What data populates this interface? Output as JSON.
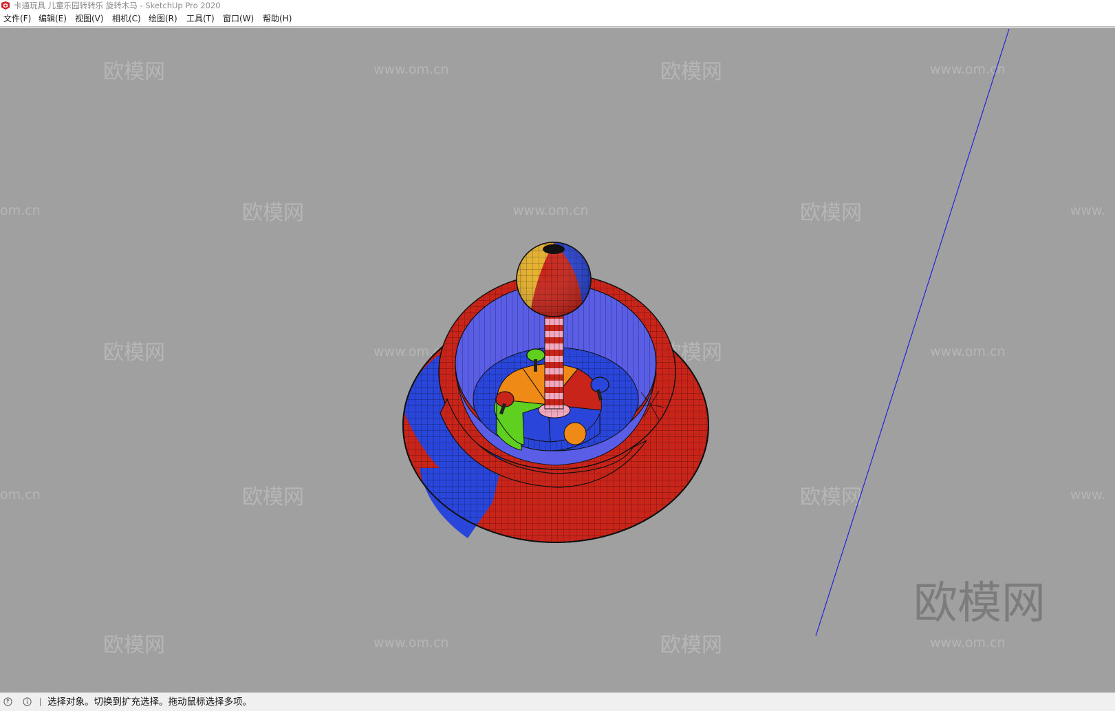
{
  "window": {
    "title": "卡通玩具 儿童乐园转转乐 旋转木马 - SketchUp Pro 2020",
    "app_icon": "sketchup-logo-icon"
  },
  "menu": {
    "items": [
      "文件(F)",
      "编辑(E)",
      "视图(V)",
      "相机(C)",
      "绘图(R)",
      "工具(T)",
      "窗口(W)",
      "帮助(H)"
    ]
  },
  "viewport": {
    "background": "#a0a0a0",
    "watermark_logo": "欧模网",
    "watermark_url": "www.om.cn",
    "watermark_url_partial_left": "om.cn",
    "watermark_url_partial_right": "www.",
    "model": {
      "colors": {
        "red": "#c8241a",
        "blue": "#2a45d9",
        "indigo": "#5a5ee6",
        "orange": "#f08a17",
        "green": "#5fd01f",
        "pink": "#f2a9c0",
        "yellow": "#e8b12a",
        "edge": "#111111"
      }
    },
    "axis_color": "#2222dd"
  },
  "status": {
    "icons": [
      "geolocation-icon",
      "info-icon"
    ],
    "text": "选择对象。切换到扩充选择。拖动鼠标选择多项。"
  }
}
